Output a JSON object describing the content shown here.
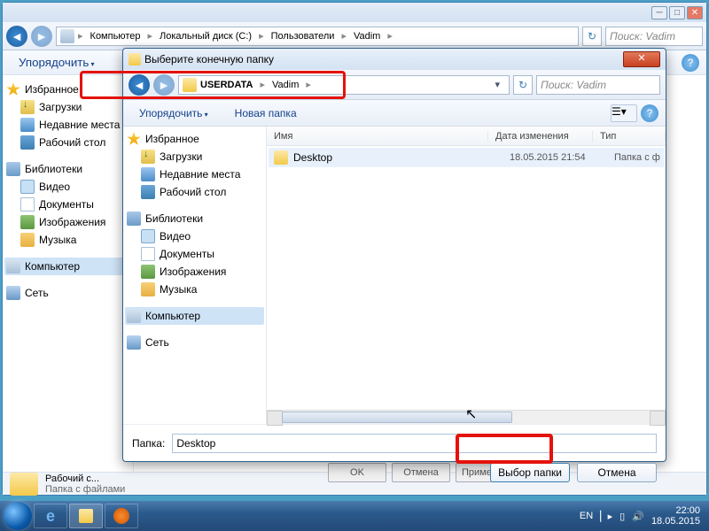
{
  "bg_window": {
    "breadcrumb": [
      "Компьютер",
      "Локальный диск (C:)",
      "Пользователи",
      "Vadim"
    ],
    "search_placeholder": "Поиск: Vadim",
    "toolbar": {
      "organize": "Упорядочить"
    },
    "sidebar": {
      "favorites": "Избранное",
      "downloads": "Загрузки",
      "recent": "Недавние места",
      "desktop": "Рабочий стол",
      "libraries": "Библиотеки",
      "video": "Видео",
      "documents": "Документы",
      "images": "Изображения",
      "music": "Музыка",
      "computer": "Компьютер",
      "network": "Сеть"
    },
    "status": {
      "name": "Рабочий с...",
      "sub": "Папка с файлами"
    },
    "under_buttons": {
      "ok": "OK",
      "cancel": "Отмена",
      "apply": "Применить"
    }
  },
  "dialog": {
    "title": "Выберите конечную папку",
    "breadcrumb": [
      "USERDATA",
      "Vadim"
    ],
    "search_placeholder": "Поиск: Vadim",
    "toolbar": {
      "organize": "Упорядочить",
      "new_folder": "Новая папка"
    },
    "sidebar": {
      "favorites": "Избранное",
      "downloads": "Загрузки",
      "recent": "Недавние места",
      "desktop": "Рабочий стол",
      "libraries": "Библиотеки",
      "video": "Видео",
      "documents": "Документы",
      "images": "Изображения",
      "music": "Музыка",
      "computer": "Компьютер",
      "network": "Сеть"
    },
    "columns": {
      "name": "Имя",
      "date": "Дата изменения",
      "type": "Тип"
    },
    "rows": [
      {
        "name": "Desktop",
        "date": "18.05.2015 21:54",
        "type": "Папка с ф"
      }
    ],
    "folder_label": "Папка:",
    "folder_value": "Desktop",
    "select_button": "Выбор папки",
    "cancel_button": "Отмена"
  },
  "taskbar": {
    "lang": "EN",
    "time": "22:00",
    "date": "18.05.2015"
  }
}
